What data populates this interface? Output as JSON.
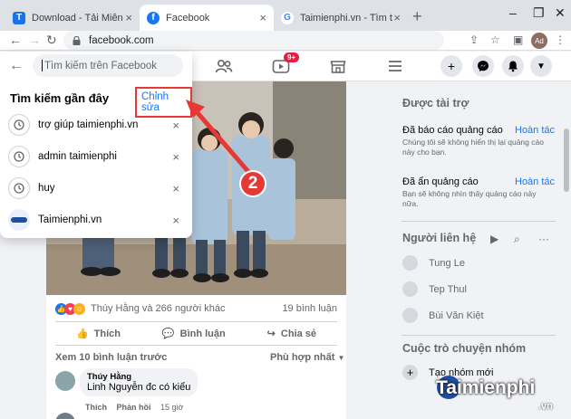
{
  "browser": {
    "tabs": [
      {
        "title": "Download - Tải Miễn Phí VN",
        "favicon": "T",
        "color": "#1a73e8"
      },
      {
        "title": "Facebook",
        "favicon": "f",
        "color": "#1877f2"
      },
      {
        "title": "Taimienphi.vn - Tìm trên Goog",
        "favicon": "G",
        "color": "#4285f4"
      }
    ],
    "new_tab": "+",
    "url": "facebook.com",
    "profile_initials": "Ad"
  },
  "facebook": {
    "notification_count": "9+",
    "search": {
      "placeholder": "Tìm kiếm trên Facebook",
      "recent_title": "Tìm kiếm gần đây",
      "edit_label": "Chỉnh sửa",
      "items": [
        {
          "label": "trợ giúp taimienphi.vn",
          "icon": "clock-icon"
        },
        {
          "label": "admin taimienphi",
          "icon": "clock-icon"
        },
        {
          "label": "huy",
          "icon": "clock-icon"
        },
        {
          "label": "Taimienphi.vn",
          "icon": "page-logo"
        }
      ]
    },
    "post": {
      "reactions_text": "Thúy Hằng và 266 người khác",
      "comments_count": "19 bình luận",
      "like_label": "Thích",
      "comment_label": "Bình luận",
      "share_label": "Chia sẻ",
      "more_comments": "Xem 10 bình luận trước",
      "sort_label": "Phù hợp nhất",
      "comment": {
        "author": "Thúy Hằng",
        "text": "Linh Nguyễn đc có kiểu",
        "like": "Thích",
        "reply": "Phản hồi",
        "time": "15 giờ"
      }
    },
    "sidebar": {
      "sponsored_title": "Được tài trợ",
      "ads": [
        {
          "title": "Đã báo cáo quảng cáo",
          "undo": "Hoàn tác",
          "desc": "Chúng tôi sẽ không hiển thị lại quảng cáo này cho bạn."
        },
        {
          "title": "Đã ẩn quảng cáo",
          "undo": "Hoàn tác",
          "desc": "Bạn sẽ không nhìn thấy quảng cáo này nữa."
        }
      ],
      "contacts_title": "Người liên hệ",
      "contacts": [
        "Tung Le",
        "Tep Thul",
        "Bùi Văn Kiệt"
      ],
      "group_title": "Cuộc trò chuyện nhóm",
      "create_group": "Tạo nhóm mới"
    }
  },
  "annotation": {
    "step": "2",
    "watermark": "Taimienphi",
    "watermark_suffix": ".vn",
    "accent_color": "#e53935"
  }
}
